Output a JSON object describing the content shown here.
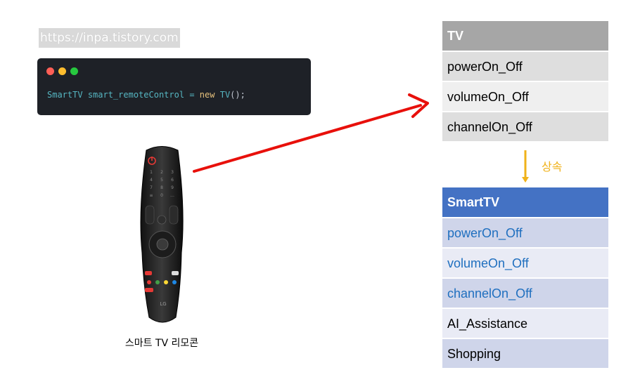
{
  "url_label": "https://inpa.tistory.com",
  "code": {
    "window_dots": [
      "#ff5f56",
      "#ffbd2e",
      "#27c93f"
    ],
    "type_name": "SmartTV",
    "var_name": "smart_remoteControl",
    "operator": "=",
    "keyword": "new",
    "constructor": "TV",
    "tail": "();"
  },
  "remote": {
    "caption": "스마트 TV 리모콘",
    "brand": "LG"
  },
  "arrow_color": "#e8100b",
  "inherit": {
    "label": "상속",
    "color": "#f0b21a"
  },
  "tv_table": {
    "header": "TV",
    "rows": [
      "powerOn_Off",
      "volumeOn_Off",
      "channelOn_Off"
    ]
  },
  "smarttv_table": {
    "header": "SmartTV",
    "rows": [
      "powerOn_Off",
      "volumeOn_Off",
      "channelOn_Off",
      "AI_Assistance",
      "Shopping"
    ]
  }
}
